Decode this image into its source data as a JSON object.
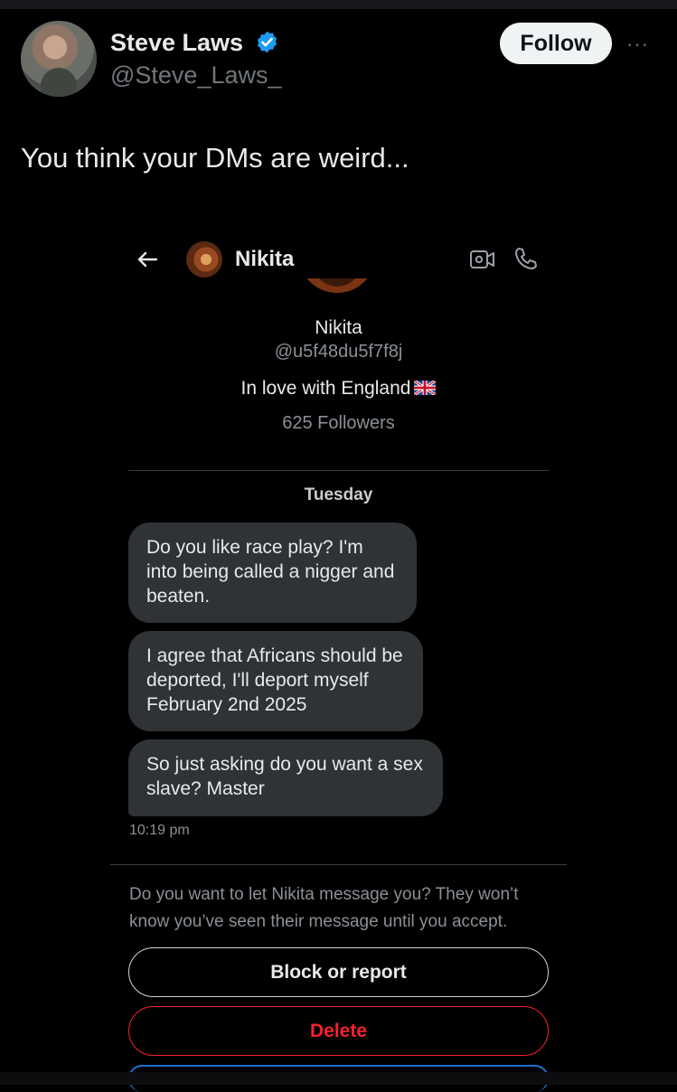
{
  "tweet": {
    "author_name": "Steve Laws",
    "author_handle": "@Steve_Laws_",
    "follow_label": "Follow",
    "more_label": "···",
    "text": "You think your DMs are weird..."
  },
  "dm": {
    "header_name": "Nikita",
    "profile": {
      "name": "Nikita",
      "handle": "@u5f48du5f7f8j",
      "bio": "In love with England",
      "followers": "625 Followers"
    },
    "day_label": "Tuesday",
    "messages": [
      "Do you like race play? I'm into being called a nigger and beaten.",
      "I agree that Africans should be deported, I'll deport myself February 2nd 2025",
      "So just asking do you want a sex slave? Master"
    ],
    "timestamp": "10:19 pm",
    "request_prompt": "Do you want to let Nikita message you? They won’t know you’ve seen their message until you accept.",
    "block_label": "Block or report",
    "delete_label": "Delete"
  },
  "colors": {
    "background": "#000000",
    "bubble": "#2f3336",
    "delete_red": "#f4212e",
    "verified_blue": "#1d9bf0"
  },
  "icons": [
    "verified-badge-icon",
    "back-arrow-icon",
    "video-call-icon",
    "phone-icon",
    "uk-flag-icon"
  ]
}
